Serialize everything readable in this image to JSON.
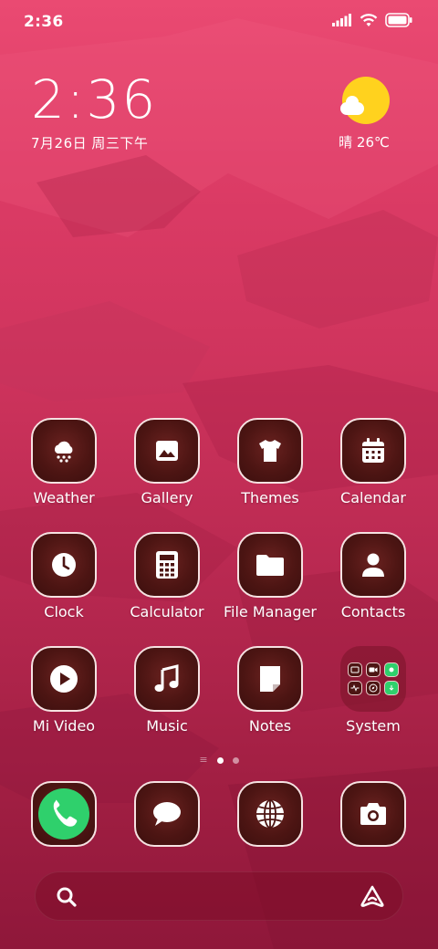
{
  "status_bar": {
    "time": "2:36",
    "icons": [
      "signal-icon",
      "wifi-icon",
      "battery-icon"
    ]
  },
  "clock_widget": {
    "time": "2:36",
    "date": "7月26日 周三下午"
  },
  "weather_widget": {
    "icon": "sunny-cloud-icon",
    "text": "晴 26℃"
  },
  "apps": [
    {
      "label": "Weather",
      "icon": "weather-snow-icon"
    },
    {
      "label": "Gallery",
      "icon": "image-icon"
    },
    {
      "label": "Themes",
      "icon": "tshirt-icon"
    },
    {
      "label": "Calendar",
      "icon": "calendar-icon"
    },
    {
      "label": "Clock",
      "icon": "clock-icon"
    },
    {
      "label": "Calculator",
      "icon": "calculator-icon"
    },
    {
      "label": "File Manager",
      "icon": "folder-icon"
    },
    {
      "label": "Contacts",
      "icon": "person-icon"
    },
    {
      "label": "Mi Video",
      "icon": "play-icon"
    },
    {
      "label": "Music",
      "icon": "music-note-icon"
    },
    {
      "label": "Notes",
      "icon": "note-icon"
    },
    {
      "label": "System",
      "icon": "folder-grid-icon"
    }
  ],
  "page_indicator": {
    "pages": 2,
    "current": 1
  },
  "dock": [
    {
      "name": "Phone",
      "icon": "phone-icon"
    },
    {
      "name": "Messages",
      "icon": "message-icon"
    },
    {
      "name": "Browser",
      "icon": "globe-icon"
    },
    {
      "name": "Camera",
      "icon": "camera-icon"
    }
  ],
  "search_bar": {
    "icon": "search-icon",
    "assistant_icon": "assistant-icon"
  },
  "colors": {
    "phone_green": "#2fd06c",
    "sun_yellow": "#ffd21e",
    "tile_border": "#f6e2e2"
  }
}
